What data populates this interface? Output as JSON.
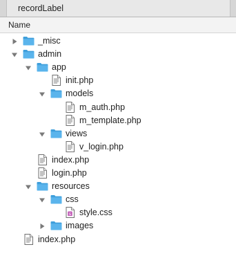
{
  "tab": {
    "title": "recordLabel"
  },
  "column_header": {
    "name": "Name"
  },
  "tree": [
    {
      "label": "_misc",
      "kind": "folder",
      "disclosure": "collapsed",
      "depth": 0
    },
    {
      "label": "admin",
      "kind": "folder",
      "disclosure": "expanded",
      "depth": 0
    },
    {
      "label": "app",
      "kind": "folder",
      "disclosure": "expanded",
      "depth": 1
    },
    {
      "label": "init.php",
      "kind": "file",
      "depth": 2
    },
    {
      "label": "models",
      "kind": "folder",
      "disclosure": "expanded",
      "depth": 2
    },
    {
      "label": "m_auth.php",
      "kind": "file",
      "depth": 3
    },
    {
      "label": "m_template.php",
      "kind": "file",
      "depth": 3
    },
    {
      "label": "views",
      "kind": "folder",
      "disclosure": "expanded",
      "depth": 2
    },
    {
      "label": "v_login.php",
      "kind": "file",
      "depth": 3
    },
    {
      "label": "index.php",
      "kind": "file",
      "depth": 1
    },
    {
      "label": "login.php",
      "kind": "file",
      "depth": 1
    },
    {
      "label": "resources",
      "kind": "folder",
      "disclosure": "expanded",
      "depth": 1
    },
    {
      "label": "css",
      "kind": "folder",
      "disclosure": "expanded",
      "depth": 2
    },
    {
      "label": "style.css",
      "kind": "css-file",
      "depth": 3
    },
    {
      "label": "images",
      "kind": "folder",
      "disclosure": "collapsed",
      "depth": 2
    },
    {
      "label": "index.php",
      "kind": "file",
      "depth": 0
    }
  ],
  "colors": {
    "folder": "#5ab4ec",
    "folder_dark": "#3f9fdb",
    "disclosure": "#7a7a7a"
  }
}
